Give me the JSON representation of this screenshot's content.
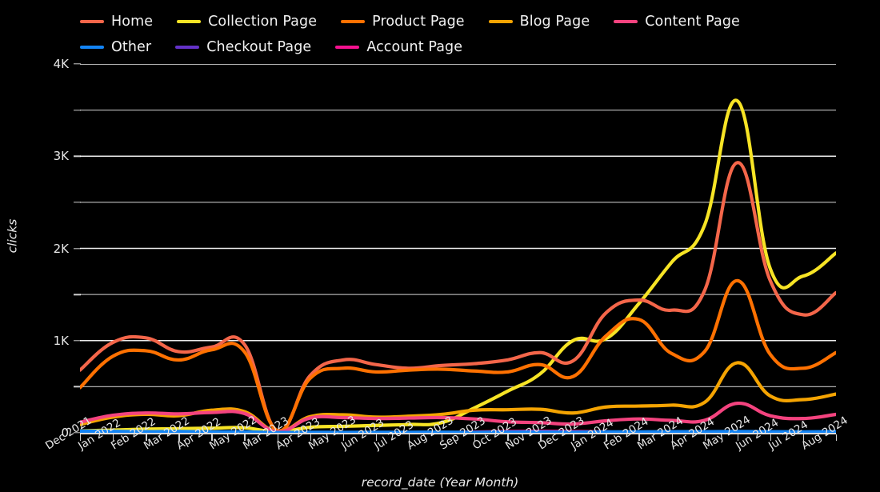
{
  "chart_data": {
    "type": "line",
    "title": "",
    "xlabel": "record_date (Year Month)",
    "ylabel": "clicks",
    "ylim": [
      0,
      4000
    ],
    "ytick_values": [
      0,
      1000,
      2000,
      3000,
      4000
    ],
    "ytick_labels": [
      "0",
      "1K",
      "2K",
      "3K",
      "4K"
    ],
    "yminor_values": [
      500,
      1500,
      2500,
      3500
    ],
    "grid": true,
    "grid_color": "#ffffff",
    "background": "#000000",
    "legend_position": "top",
    "categories": [
      "Dec 2021",
      "Jan 2022",
      "Feb 2022",
      "Mar 2022",
      "Apr 2022",
      "May 2022",
      "Mar 2023",
      "Apr 2023",
      "May 2023",
      "Jun 2023",
      "Jul 2023",
      "Aug 2023",
      "Sep 2023",
      "Oct 2023",
      "Nov 2023",
      "Dec 2023",
      "Jan 2024",
      "Feb 2024",
      "Mar 2024",
      "Apr 2024",
      "May 2024",
      "Jun 2024",
      "Jul 2024",
      "Aug 2024"
    ],
    "series": [
      {
        "name": "Home",
        "color": "#f4664a",
        "values": [
          680,
          980,
          1030,
          880,
          930,
          960,
          20,
          620,
          790,
          740,
          700,
          730,
          750,
          790,
          870,
          780,
          1300,
          1440,
          1330,
          1540,
          2930,
          1650,
          1280,
          1520
        ]
      },
      {
        "name": "Collection Page",
        "color": "#f7e425",
        "values": [
          20,
          30,
          40,
          45,
          50,
          55,
          10,
          60,
          70,
          80,
          90,
          110,
          270,
          450,
          640,
          1000,
          1020,
          1400,
          1850,
          2250,
          3600,
          1780,
          1700,
          1950
        ]
      },
      {
        "name": "Product Page",
        "color": "#ff7101",
        "values": [
          490,
          830,
          890,
          790,
          900,
          880,
          25,
          590,
          700,
          660,
          680,
          690,
          670,
          660,
          740,
          610,
          1050,
          1230,
          860,
          880,
          1650,
          850,
          700,
          870
        ]
      },
      {
        "name": "Blog Page",
        "color": "#f5a402",
        "values": [
          90,
          170,
          200,
          185,
          245,
          230,
          15,
          175,
          195,
          170,
          180,
          200,
          245,
          250,
          255,
          215,
          280,
          290,
          300,
          330,
          760,
          400,
          360,
          420
        ]
      },
      {
        "name": "Content Page",
        "color": "#f4437f",
        "values": [
          115,
          190,
          215,
          205,
          220,
          210,
          12,
          160,
          165,
          155,
          160,
          165,
          150,
          120,
          110,
          95,
          130,
          150,
          135,
          135,
          320,
          185,
          155,
          200
        ]
      },
      {
        "name": "Other",
        "color": "#1384f5",
        "values": [
          18,
          15,
          12,
          14,
          10,
          10,
          4,
          6,
          5,
          6,
          6,
          7,
          5,
          8,
          9,
          7,
          10,
          10,
          12,
          12,
          14,
          12,
          10,
          12
        ]
      },
      {
        "name": "Checkout Page",
        "color": "#6432c8",
        "values": [
          0,
          0,
          0,
          0,
          0,
          0,
          0,
          0,
          0,
          0,
          0,
          0,
          0,
          0,
          0,
          0,
          0,
          0,
          0,
          0,
          0,
          0,
          5,
          10
        ]
      },
      {
        "name": "Account Page",
        "color": "#f5118f",
        "values": [
          0,
          0,
          0,
          0,
          0,
          0,
          0,
          0,
          0,
          0,
          0,
          0,
          8,
          14,
          16,
          14,
          10,
          0,
          0,
          0,
          0,
          0,
          0,
          0
        ]
      }
    ]
  }
}
